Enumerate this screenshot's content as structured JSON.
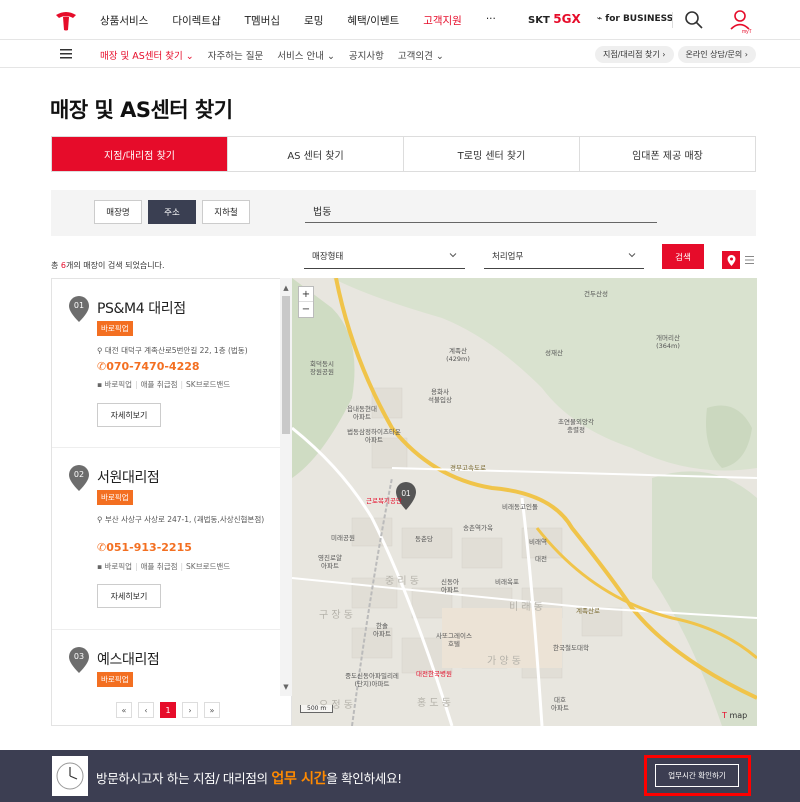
{
  "header": {
    "menu": [
      "상품서비스",
      "다이렉트샵",
      "T멤버십",
      "로밍",
      "혜택/이벤트",
      "고객지원"
    ],
    "active_menu": "고객지원",
    "more": "···",
    "skt5g_prefix": "SKT",
    "skt5g_brand": "5GX",
    "for_business": "for BUSINESS"
  },
  "lnb": {
    "items": [
      "매장 및 AS센터 찾기 ⌄",
      "자주하는 질문",
      "서비스 안내 ⌄",
      "공지사항",
      "고객의견 ⌄"
    ],
    "pills": [
      "지점/대리점 찾기 ›",
      "온라인 상담/문의 ›"
    ]
  },
  "page": {
    "title": "매장 및 AS센터 찾기"
  },
  "tabs": [
    "지점/대리점 찾기",
    "AS 센터 찾기",
    "T로밍 센터 찾기",
    "임대폰 제공 매장"
  ],
  "search": {
    "types": [
      "매장명",
      "주소",
      "지하철"
    ],
    "active_type": "주소",
    "value": "법동",
    "count_prefix": "총 ",
    "count": "6",
    "count_suffix": "개의 매장이 검색 되었습니다.",
    "select1": "매장형태",
    "select2": "처리업무",
    "button": "검색"
  },
  "stores": [
    {
      "num": "01",
      "name": "PS&M4 대리점",
      "badge": "바로픽업",
      "address": "대전 대덕구 계족산로5번안길 22, 1층 (법동)",
      "phone": "070-7470-4228",
      "services": [
        "바로픽업",
        "애플 취급점",
        "SK브로드밴드"
      ],
      "detail": "자세히보기"
    },
    {
      "num": "02",
      "name": "서원대리점",
      "badge": "바로픽업",
      "address": "부산 사상구 사상로 247-1, (괘법동,사상신협본점)",
      "phone": "051-913-2215",
      "services": [
        "바로픽업",
        "애플 취급점",
        "SK브로드밴드"
      ],
      "detail": "자세히보기"
    },
    {
      "num": "03",
      "name": "예스대리점",
      "badge": "바로픽업"
    }
  ],
  "pagination": {
    "first": "«",
    "prev": "‹",
    "current": "1",
    "next": "›",
    "last": "»"
  },
  "map": {
    "labels": [
      "건두산성",
      "계족산\n(429m)",
      "개머리산\n(364m)",
      "성재산",
      "용화사\n석불입상",
      "초연물외앙각\n충렬정",
      "회덕동시\n장원공원",
      "읍내동현대\n아파트",
      "법동삼정하이츠타운\n아파트",
      "근로복지공단",
      "비래동고인돌",
      "송촌역가옥",
      "동춘당",
      "비래역",
      "대전",
      "미래공원",
      "영진로얄\n아파트",
      "신동아\n아파트",
      "비래옥포",
      "한국철도대학",
      "사또그레이스\n호텔",
      "한솔\n아파트",
      "중도신동아파밀리레\n(단지)아파트",
      "대전한국병원",
      "대호\n아파트",
      "경부고속도로",
      "계족산로",
      "비 래 동",
      "가 양 동",
      "홍 도 동",
      "중 리 동",
      "구 장 동",
      "오 정 동"
    ],
    "scale": "500 m",
    "brand": "map",
    "pin": "01"
  },
  "footer": {
    "text_before": "방문하시고자 하는 지점/ 대리점의 ",
    "text_highlight": "업무 시간",
    "text_after": "을 확인하세요!",
    "button": "업무시간 확인하기"
  },
  "colors": {
    "brand_red": "#e60c2a",
    "orange": "#f36f21",
    "footer_bg": "#3c3e52",
    "highlight_box": "#ff0000"
  }
}
